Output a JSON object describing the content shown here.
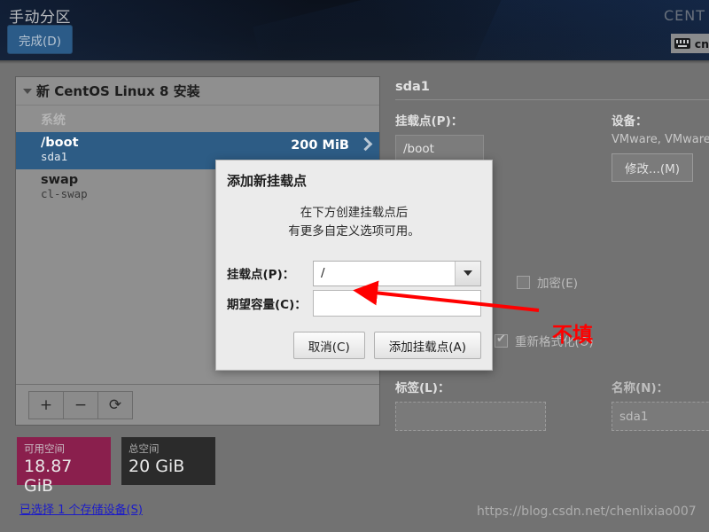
{
  "header": {
    "title": "手动分区",
    "done_label": "完成(D)",
    "brand": "CENT",
    "keyboard_layout": "cn",
    "keyboard_icon": "keyboard-icon"
  },
  "left_panel": {
    "tree_header": "新 CentOS Linux 8 安装",
    "group_label": "系统",
    "partitions": [
      {
        "name": "/boot",
        "device": "sda1",
        "size": "200 MiB",
        "selected": true
      },
      {
        "name": "swap",
        "device": "cl-swap",
        "size": "",
        "selected": false
      }
    ],
    "toolbar": {
      "add_label": "+",
      "remove_label": "−",
      "refresh_label": "⟳"
    }
  },
  "space_summary": {
    "available": {
      "caption": "可用空间",
      "value": "18.87 GiB",
      "color": "#8a1f4d"
    },
    "total": {
      "caption": "总空间",
      "value": "20 GiB",
      "color": "#2b2b2b"
    },
    "storage_link": "已选择 1 个存储设备(S)"
  },
  "details": {
    "device_title": "sda1",
    "mount_point_label": "挂载点(P)：",
    "mount_point_value": "/boot",
    "device_label": "设备：",
    "device_value": "VMware, VMware V",
    "modify_button": "修改...(M)",
    "encrypt_label": "加密(E)",
    "encrypt_checked": false,
    "reformat_label": "重新格式化(O)",
    "reformat_checked": true,
    "label_label": "标签(L)：",
    "label_value": "",
    "name_label": "名称(N)：",
    "name_value": "sda1"
  },
  "dialog": {
    "title": "添加新挂载点",
    "description_line1": "在下方创建挂载点后",
    "description_line2": "有更多自定义选项可用。",
    "mount_point_label": "挂载点(P)：",
    "mount_point_value": "/",
    "capacity_label": "期望容量(C)：",
    "capacity_value": "",
    "cancel_label": "取消(C)",
    "confirm_label": "添加挂载点(A)"
  },
  "annotation": {
    "text": "不填",
    "color": "#ff0000"
  },
  "watermark": "https://blog.csdn.net/chenlixiao007"
}
